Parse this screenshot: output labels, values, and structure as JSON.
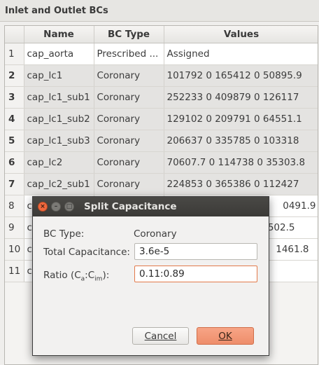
{
  "panel": {
    "title": "Inlet and Outlet BCs"
  },
  "table": {
    "headers": [
      "Name",
      "BC Type",
      "Values"
    ],
    "rows": [
      {
        "num": "1",
        "name": "cap_aorta",
        "bc_type": "Prescribed ...",
        "values": "Assigned"
      },
      {
        "num": "2",
        "name": "cap_lc1",
        "bc_type": "Coronary",
        "values": "101792 0 165412 0 50895.9"
      },
      {
        "num": "3",
        "name": "cap_lc1_sub1",
        "bc_type": "Coronary",
        "values": "252233 0 409879 0 126117"
      },
      {
        "num": "4",
        "name": "cap_lc1_sub2",
        "bc_type": "Coronary",
        "values": "129102 0 209791 0 64551.1"
      },
      {
        "num": "5",
        "name": "cap_lc1_sub3",
        "bc_type": "Coronary",
        "values": "206637 0 335785 0 103318"
      },
      {
        "num": "6",
        "name": "cap_lc2",
        "bc_type": "Coronary",
        "values": "70607.7 0 114738 0 35303.8"
      },
      {
        "num": "7",
        "name": "cap_lc2_sub1",
        "bc_type": "Coronary",
        "values": "224853 0 365386 0 112427"
      },
      {
        "num": "8",
        "name": "ca",
        "bc_type": "",
        "values": "0491.9"
      },
      {
        "num": "9",
        "name": "ca",
        "bc_type": "",
        "values": "502.5"
      },
      {
        "num": "10",
        "name": "ca",
        "bc_type": "",
        "values": "1461.8"
      },
      {
        "num": "11",
        "name": "ca",
        "bc_type": "",
        "values": ""
      }
    ]
  },
  "dialog": {
    "title": "Split Capacitance",
    "bc_type_label": "BC Type:",
    "bc_type_value": "Coronary",
    "total_cap_label": "Total Capacitance:",
    "total_cap_value": "3.6e-5",
    "ratio_label_prefix": "Ratio (C",
    "ratio_sub_a": "a",
    "ratio_colon": ":C",
    "ratio_sub_im": "im",
    "ratio_label_suffix": "):",
    "ratio_value": "0.11:0.89",
    "cancel_label": "Cancel",
    "ok_label": "OK",
    "titlebar_buttons": {
      "close": "×",
      "minimize": "–",
      "maximize": "□"
    }
  },
  "colors": {
    "accent": "#ee8e6b",
    "focus_border": "#e27a4a",
    "titlebar": "#3b3a37"
  }
}
